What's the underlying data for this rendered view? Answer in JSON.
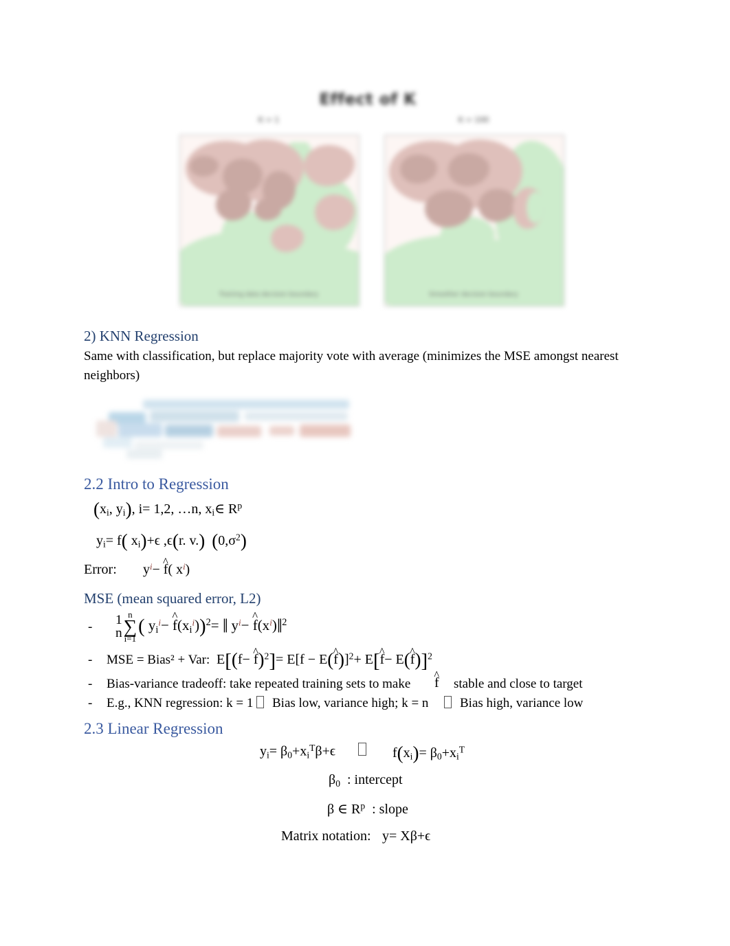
{
  "document": {
    "type": "lecture-notes",
    "page_background": "#ffffff",
    "heading_color_dark": "#23406e",
    "heading_color_blue": "#39599f"
  },
  "figure_knn": {
    "name": "knn-effect-of-k-figure",
    "title": "Effect of K",
    "blurred": true,
    "panels": [
      {
        "label": "K = 1",
        "caption": "Training data decision boundary"
      },
      {
        "label": "K = 100",
        "caption": "Smoother decision boundary"
      }
    ]
  },
  "figure_formula": {
    "name": "knn-regression-formula-screenshot",
    "blurred": true,
    "description": "blurred pasted screenshot of KNN regression averaging formula"
  },
  "section_knn_regression": {
    "heading": "2) KNN Regression",
    "body": "Same with classification, but replace majority vote with average (minimizes the MSE amongst nearest neighbors)"
  },
  "section_intro_regression": {
    "heading": "2.2 Intro to Regression",
    "formula_data": "(xᵢ, yᵢ), i = 1, 2, … n, xᵢ ∈ Rᵖ",
    "formula_model": "yᵢ = f(xᵢ) + ϵ , ϵ (r. v.) (0, σ²)",
    "error_label": "Error:",
    "error_formula": "yⁱ − f̂(xⁱ)"
  },
  "section_mse": {
    "heading": "MSE (mean squared error, L2)",
    "bullets": [
      {
        "dash": "-",
        "text": "",
        "formula": "1/n Σᵢ₌₁ⁿ ( yᵢⁱ − f̂(xᵢⁱ) )² = ‖ yⁱ − f̂(xⁱ) ‖²"
      },
      {
        "dash": "-",
        "text": "MSE = Bias² + Var:",
        "formula": "E[(f − f̂)²] = E[f − E(f̂)]² + E[f̂ − E(f̂)]²"
      },
      {
        "dash": "-",
        "text": "Bias-variance tradeoff: take repeated training sets to make",
        "text_after": "stable and close to target",
        "formula": "f̂"
      },
      {
        "dash": "-",
        "text": "E.g., KNN regression: k = 1",
        "text_mid": "Bias low, variance high; k = n",
        "text_after": "Bias high, variance low"
      }
    ]
  },
  "section_linear_regression": {
    "heading": "2.3 Linear Regression",
    "main_formula_left": "yᵢ = β₀ + xᵢᵀ β + ϵ",
    "main_formula_right": "f(xᵢ) = β₀ + xᵢᵀ",
    "intercept_line": "β₀  : intercept",
    "slope_line": "β ∈ Rᵖ  : slope",
    "matrix_label": "Matrix notation:",
    "matrix_formula": "y = Xβ + ϵ"
  }
}
